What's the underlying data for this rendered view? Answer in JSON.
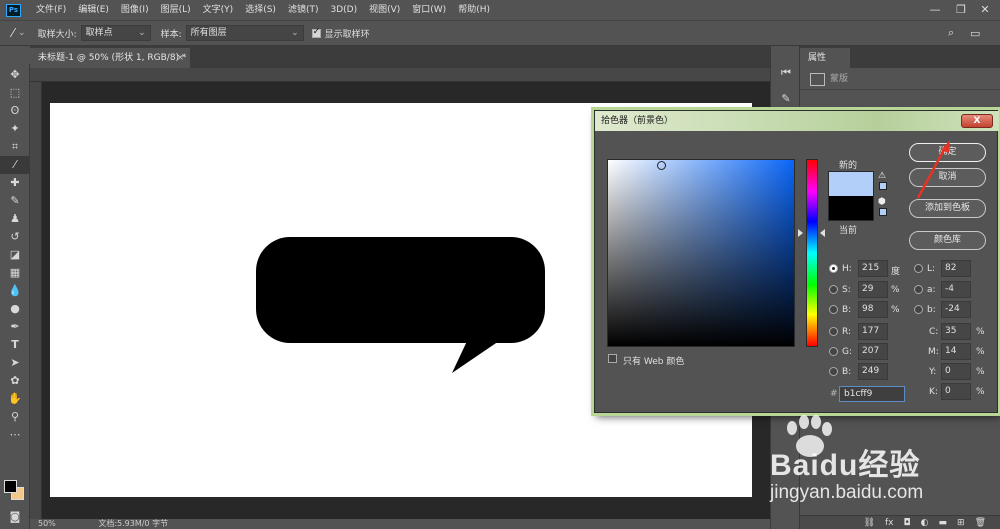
{
  "menu": {
    "items": [
      "文件(F)",
      "编辑(E)",
      "图像(I)",
      "图层(L)",
      "文字(Y)",
      "选择(S)",
      "滤镜(T)",
      "3D(D)",
      "视图(V)",
      "窗口(W)",
      "帮助(H)"
    ]
  },
  "options": {
    "sample_size_label": "取样大小:",
    "sample_size_value": "取样点",
    "sample_label": "样本:",
    "sample_value": "所有图层",
    "show_ring_label": "显示取样环"
  },
  "document": {
    "tab_title": "未标题-1 @ 50% (形状 1, RGB/8) *",
    "close": "×"
  },
  "status": {
    "zoom": "50%",
    "doc_info": "文档:5.93M/0 字节"
  },
  "panel": {
    "tab": "属性",
    "row1": "蒙版"
  },
  "dialog": {
    "title": "拾色器（前景色）",
    "close": "X",
    "new_label": "新的",
    "current_label": "当前",
    "ok": "确定",
    "cancel": "取消",
    "add_swatch": "添加到色板",
    "color_libraries": "颜色库",
    "web_only": "只有 Web 颜色",
    "new_color": "#b1cff9",
    "current_color": "#000000",
    "hex_prefix": "#",
    "hex": "b1cff9",
    "fields": {
      "H": {
        "label": "H:",
        "value": "215",
        "unit": "度"
      },
      "S": {
        "label": "S:",
        "value": "29",
        "unit": "%"
      },
      "B": {
        "label": "B:",
        "value": "98",
        "unit": "%"
      },
      "R": {
        "label": "R:",
        "value": "177"
      },
      "G": {
        "label": "G:",
        "value": "207"
      },
      "Bl": {
        "label": "B:",
        "value": "249"
      },
      "L": {
        "label": "L:",
        "value": "82"
      },
      "a": {
        "label": "a:",
        "value": "-4"
      },
      "b": {
        "label": "b:",
        "value": "-24"
      },
      "C": {
        "label": "C:",
        "value": "35",
        "unit": "%"
      },
      "M": {
        "label": "M:",
        "value": "14",
        "unit": "%"
      },
      "Y": {
        "label": "Y:",
        "value": "0",
        "unit": "%"
      },
      "K": {
        "label": "K:",
        "value": "0",
        "unit": "%"
      }
    }
  },
  "watermark": {
    "brand": "Baidu经验",
    "url": "jingyan.baidu.com"
  }
}
